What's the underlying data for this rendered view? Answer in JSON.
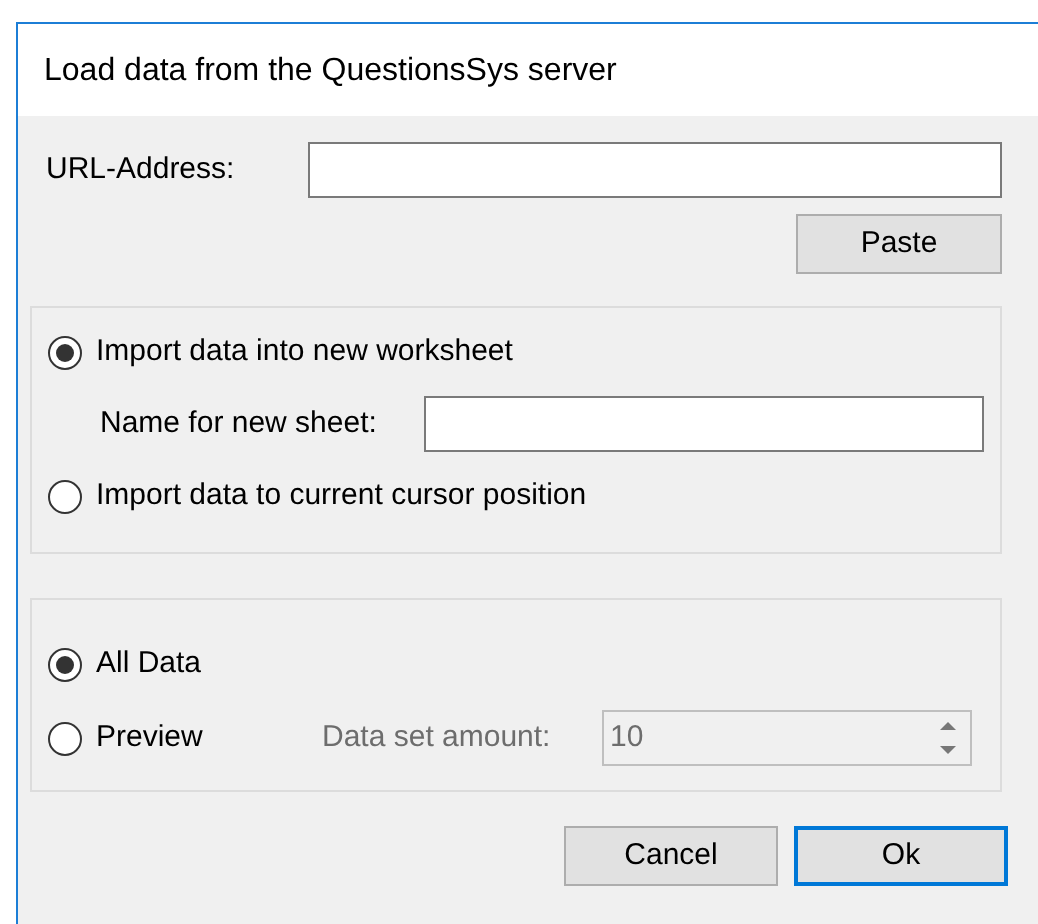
{
  "window": {
    "title": "Load data from the QuestionsSys server"
  },
  "url": {
    "label": "URL-Address:"
  },
  "paste_button": {
    "label": "Paste"
  },
  "import_target": {
    "options": [
      {
        "label": "Import data into new worksheet",
        "selected": true
      },
      {
        "label": "Import data to current cursor position",
        "selected": false
      }
    ],
    "sheet_name": {
      "label": "Name for new sheet:"
    }
  },
  "data_scope": {
    "options": [
      {
        "label": "All Data",
        "selected": true
      },
      {
        "label": "Preview",
        "selected": false
      }
    ],
    "amount": {
      "label": "Data set amount:",
      "value": "10",
      "disabled": true
    }
  },
  "buttons": [
    {
      "label": "Cancel",
      "default": false
    },
    {
      "label": "Ok",
      "default": true
    }
  ]
}
